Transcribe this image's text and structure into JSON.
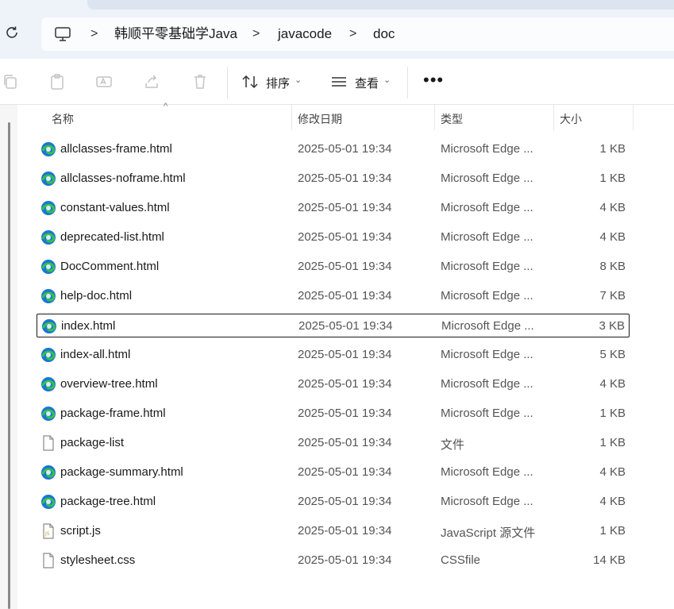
{
  "address": {
    "crumbs": [
      "韩顺平零基础学Java",
      "javacode",
      "doc"
    ],
    "separator": ">"
  },
  "toolbar": {
    "sort_label": "排序",
    "view_label": "查看",
    "more_label": "•••"
  },
  "columns": {
    "name": "名称",
    "date": "修改日期",
    "type": "类型",
    "size": "大小"
  },
  "files": [
    {
      "name": "allclasses-frame.html",
      "date": "2025-05-01 19:34",
      "type": "Microsoft Edge ...",
      "size": "1 KB",
      "icon": "edge-icon"
    },
    {
      "name": "allclasses-noframe.html",
      "date": "2025-05-01 19:34",
      "type": "Microsoft Edge ...",
      "size": "1 KB",
      "icon": "edge-icon"
    },
    {
      "name": "constant-values.html",
      "date": "2025-05-01 19:34",
      "type": "Microsoft Edge ...",
      "size": "4 KB",
      "icon": "edge-icon"
    },
    {
      "name": "deprecated-list.html",
      "date": "2025-05-01 19:34",
      "type": "Microsoft Edge ...",
      "size": "4 KB",
      "icon": "edge-icon"
    },
    {
      "name": "DocComment.html",
      "date": "2025-05-01 19:34",
      "type": "Microsoft Edge ...",
      "size": "8 KB",
      "icon": "edge-icon"
    },
    {
      "name": "help-doc.html",
      "date": "2025-05-01 19:34",
      "type": "Microsoft Edge ...",
      "size": "7 KB",
      "icon": "edge-icon"
    },
    {
      "name": "index.html",
      "date": "2025-05-01 19:34",
      "type": "Microsoft Edge ...",
      "size": "3 KB",
      "icon": "edge-icon",
      "selected": true
    },
    {
      "name": "index-all.html",
      "date": "2025-05-01 19:34",
      "type": "Microsoft Edge ...",
      "size": "5 KB",
      "icon": "edge-icon"
    },
    {
      "name": "overview-tree.html",
      "date": "2025-05-01 19:34",
      "type": "Microsoft Edge ...",
      "size": "4 KB",
      "icon": "edge-icon"
    },
    {
      "name": "package-frame.html",
      "date": "2025-05-01 19:34",
      "type": "Microsoft Edge ...",
      "size": "1 KB",
      "icon": "edge-icon"
    },
    {
      "name": "package-list",
      "date": "2025-05-01 19:34",
      "type": "文件",
      "size": "1 KB",
      "icon": "blank-file-icon"
    },
    {
      "name": "package-summary.html",
      "date": "2025-05-01 19:34",
      "type": "Microsoft Edge ...",
      "size": "4 KB",
      "icon": "edge-icon"
    },
    {
      "name": "package-tree.html",
      "date": "2025-05-01 19:34",
      "type": "Microsoft Edge ...",
      "size": "4 KB",
      "icon": "edge-icon"
    },
    {
      "name": "script.js",
      "date": "2025-05-01 19:34",
      "type": "JavaScript 源文件",
      "size": "1 KB",
      "icon": "js-file-icon"
    },
    {
      "name": "stylesheet.css",
      "date": "2025-05-01 19:34",
      "type": "CSSfile",
      "size": "14 KB",
      "icon": "blank-file-icon"
    }
  ],
  "colors": {
    "edge_blue": "#1b76d2",
    "edge_green": "#35c14d",
    "window_bg": "#eef2f9"
  }
}
